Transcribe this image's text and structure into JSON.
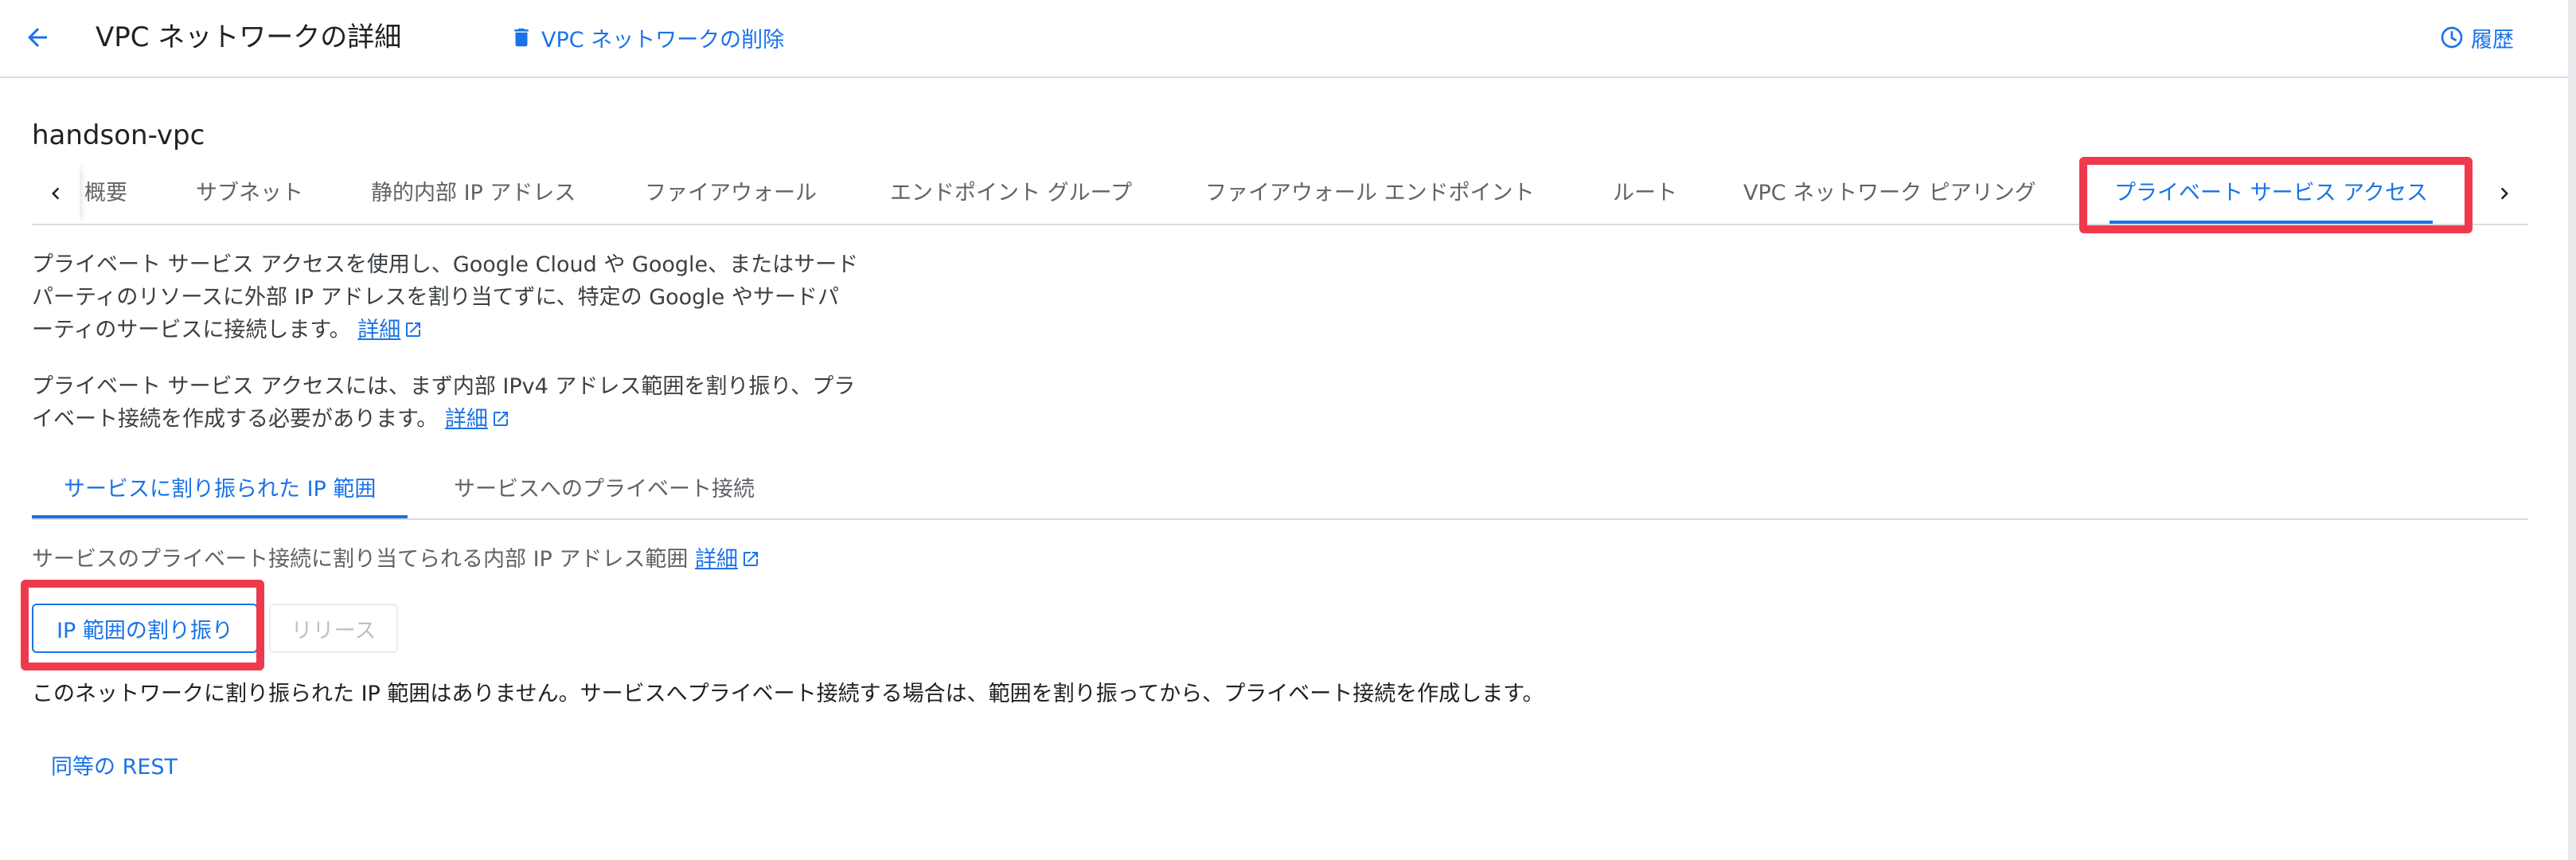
{
  "header": {
    "title": "VPC ネットワークの詳細",
    "delete_label": "VPC ネットワークの削除",
    "history_label": "履歴"
  },
  "resource_name": "handson-vpc",
  "tabs": [
    {
      "label": "概要"
    },
    {
      "label": "サブネット"
    },
    {
      "label": "静的内部 IP アドレス"
    },
    {
      "label": "ファイアウォール"
    },
    {
      "label": "エンドポイント グループ"
    },
    {
      "label": "ファイアウォール エンドポイント"
    },
    {
      "label": "ルート"
    },
    {
      "label": "VPC ネットワーク ピアリング"
    },
    {
      "label": "プライベート サービス アクセス"
    }
  ],
  "active_tab": "プライベート サービス アクセス",
  "description": {
    "para1": "プライベート サービス アクセスを使用し、Google Cloud や Google、またはサードパーティのリソースに外部 IP アドレスを割り当てずに、特定の Google やサードパーティのサービスに接続します。",
    "para2": "プライベート サービス アクセスには、まず内部 IPv4 アドレス範囲を割り振り、プライベート接続を作成する必要があります。",
    "learn_more": "詳細"
  },
  "subtabs": [
    {
      "label": "サービスに割り振られた IP 範囲"
    },
    {
      "label": "サービスへのプライベート接続"
    }
  ],
  "ip_ranges": {
    "description": "サービスのプライベート接続に割り当てられる内部 IP アドレス範囲",
    "learn_more": "詳細",
    "allocate_button": "IP 範囲の割り振り",
    "release_button": "リリース",
    "empty_message": "このネットワークに割り振られた IP 範囲はありません。サービスへプライベート接続する場合は、範囲を割り振ってから、プライベート接続を作成します。",
    "equivalent_rest": "同等の REST"
  },
  "colors": {
    "accent": "#1a73e8",
    "highlight": "#ee3a4c",
    "divider": "#dadce0"
  }
}
